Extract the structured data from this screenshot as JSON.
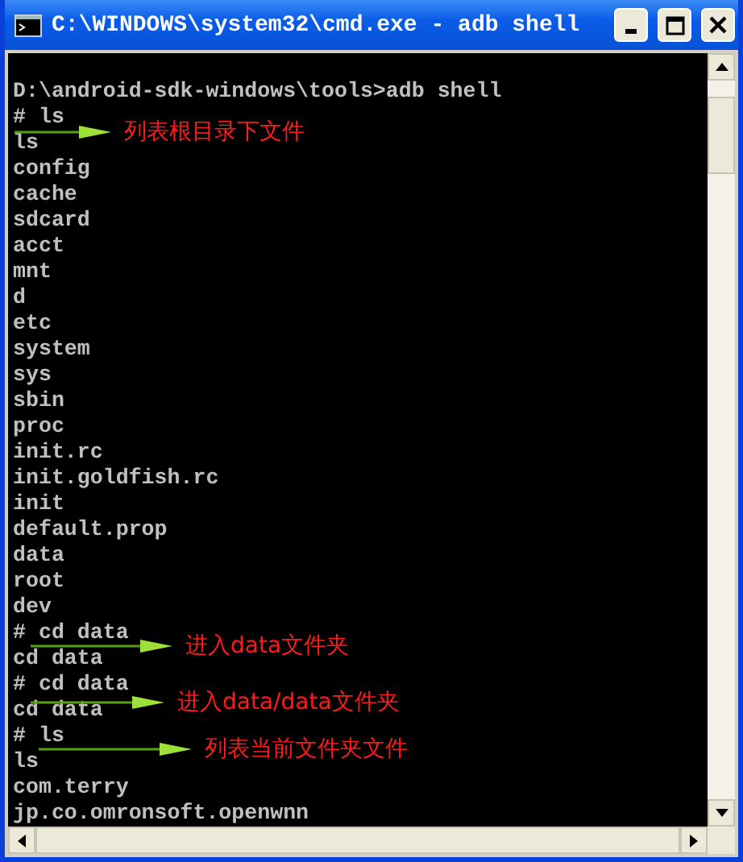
{
  "window": {
    "title": "C:\\WINDOWS\\system32\\cmd.exe - adb shell"
  },
  "console": {
    "lines": [
      "D:\\android-sdk-windows\\tools>adb shell",
      "# ls",
      "ls",
      "config",
      "cache",
      "sdcard",
      "acct",
      "mnt",
      "d",
      "etc",
      "system",
      "sys",
      "sbin",
      "proc",
      "init.rc",
      "init.goldfish.rc",
      "init",
      "default.prop",
      "data",
      "root",
      "dev",
      "# cd data",
      "cd data",
      "# cd data",
      "cd data",
      "# ls",
      "ls",
      "com.terry",
      "jp.co.omronsoft.openwnn"
    ]
  },
  "annotations": [
    {
      "text": "列表根目录下文件"
    },
    {
      "text": "进入data文件夹"
    },
    {
      "text": "进入data/data文件夹"
    },
    {
      "text": "列表当前文件夹文件"
    }
  ]
}
